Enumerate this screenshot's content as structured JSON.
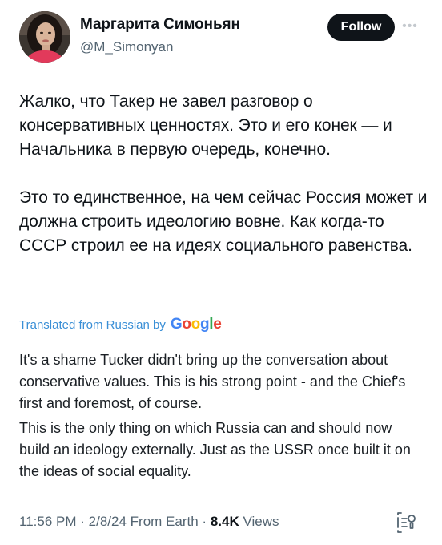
{
  "author": {
    "display_name": "Маргарита Симоньян",
    "handle": "@M_Simonyan"
  },
  "actions": {
    "follow_label": "Follow",
    "more_icon": "more-horizontal-icon"
  },
  "tweet": {
    "paragraphs": [
      "Жалко, что Такер не завел разговор о консервативных ценностях. Это и его конек — и Начальника в первую очередь, конечно.",
      "Это то единственное, на чем сейчас Россия может и должна строить идеологию вовне. Как когда-то СССР строил ее на идеях социального равенства."
    ]
  },
  "translation": {
    "label": "Translated from Russian by",
    "provider": "Google",
    "paragraphs": [
      "It's a shame Tucker didn't bring up the conversation about conservative values. This is his strong point - and the Chief's first and foremost, of course.",
      "This is the only thing on which Russia can and should now build an ideology externally. Just as the USSR once built it on the ideas of social equality."
    ]
  },
  "meta": {
    "time": "11:56 PM",
    "separator": "·",
    "date": "2/8/24",
    "source": "From Earth",
    "views_count": "8.4K",
    "views_label": "Views"
  },
  "colors": {
    "link": "#3a8fd6",
    "secondary_text": "#536471",
    "primary_text": "#0f1419",
    "follow_bg": "#0f1419"
  },
  "icons": {
    "grok": "grok-explain-icon"
  }
}
